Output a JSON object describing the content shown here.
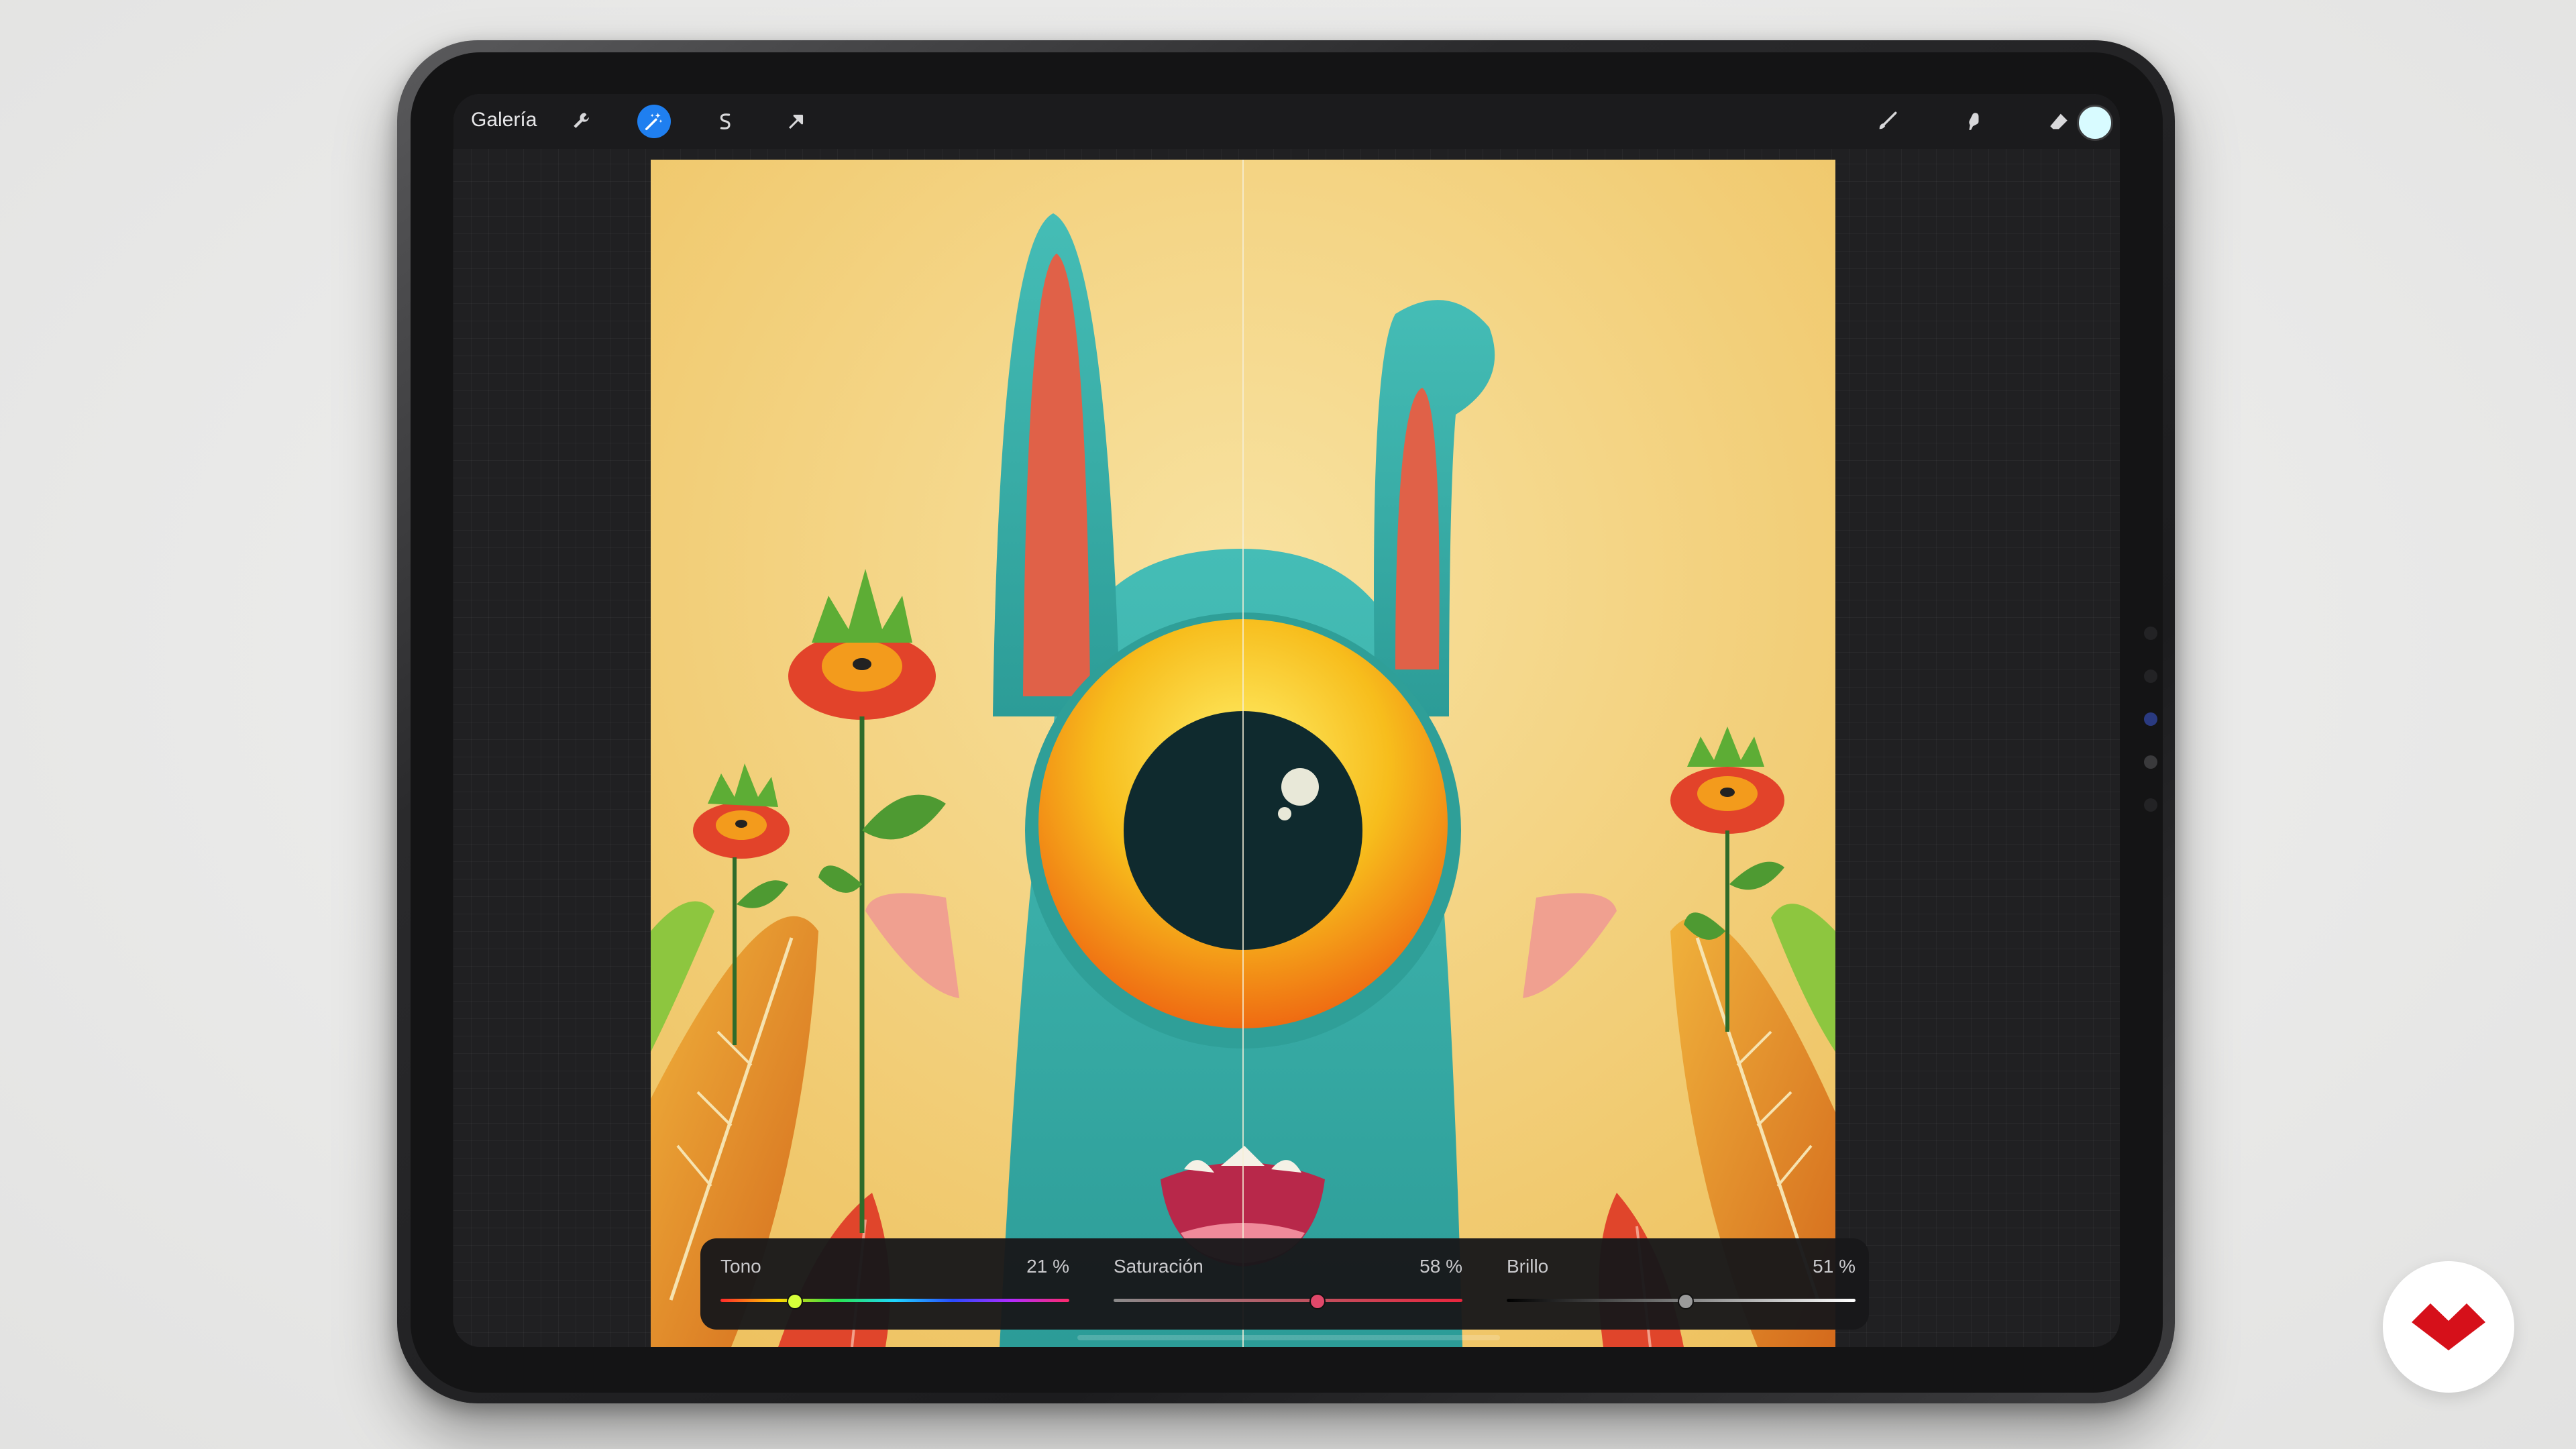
{
  "toolbar": {
    "gallery_label": "Galería",
    "left_tools": [
      "wrench-icon",
      "magic-wand-icon",
      "selection-icon",
      "transform-arrow-icon"
    ],
    "right_tools": [
      "brush-icon",
      "smudge-icon",
      "eraser-icon",
      "layers-icon"
    ],
    "active_tool": "magic-wand-icon",
    "current_color": "#d8fbff",
    "accent": "#1f7ff0"
  },
  "adjustments": {
    "hue": {
      "label": "Tono",
      "value_text": "21 %",
      "level": 0.21
    },
    "saturation": {
      "label": "Saturación",
      "value_text": "58 %",
      "level": 0.58
    },
    "brightness": {
      "label": "Brillo",
      "value_text": "51 %",
      "level": 0.51
    }
  },
  "colors": {
    "background_page": "#eaeaea",
    "canvas_background": "#f0c96a",
    "monster": "#3bb4ad",
    "eye_iris": "#f4b11a",
    "flower": "#e2432a",
    "leaf": "#e89a2a",
    "badge_logo": "#d6101a"
  }
}
